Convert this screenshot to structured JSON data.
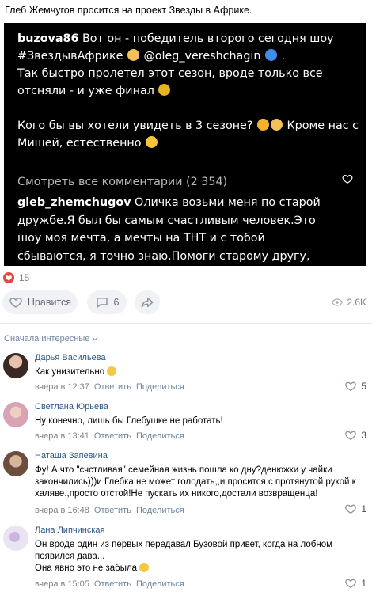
{
  "post": {
    "text": "Глеб Жемчугов просится на проект Звезды в Африке."
  },
  "screenshot": {
    "author1": "buzova86",
    "caption_part1": " Вот он - победитель второго сегодня шоу",
    "hashtag": "#ЗвездывАфрике",
    "mention": "@oleg_vereshchagin",
    "caption_part2": "Так быстро пролетел этот сезон, вроде только все отсняли - и уже финал",
    "caption_part3": "Кого бы вы хотели увидеть в 3 сезоне?",
    "caption_part4": "Кроме нас с Мишей, естественно",
    "view_all": "Смотреть все комментарии (2 354)",
    "author2": "gleb_zhemchugov",
    "reply_text": " Оличка возьми меня по старой дружбе.Я был бы самым счастливым человек.Это шоу моя мечта, а мечты на ТНТ и с тобой сбываются, я точно знаю.Помоги старому другу, пожалуйста"
  },
  "stats": {
    "reactions": "15",
    "like_label": "Нравится",
    "comments": "6",
    "views": "2.6K"
  },
  "sort_label": "Сначала интересные",
  "comments": [
    {
      "author": "Дарья Васильева",
      "text": "Как унизительно",
      "time": "вчера в 12:37",
      "reply": "Ответить",
      "share": "Поделиться",
      "likes": "5"
    },
    {
      "author": "Светлана Юрьева",
      "text": "Ну конечно, лишь бы Глебушке не работать!",
      "time": "вчера в 13:41",
      "reply": "Ответить",
      "share": "Поделиться",
      "likes": "3"
    },
    {
      "author": "Наташа Запевина",
      "text": "Фу! А что \"счстливая\" семейная жизнь пошла ко дну?денюжки у чайки закончились)))и Глебка не может голодать,,и просится с протянутой рукой к халяве.,просто отстой!Не пускать их никого,достали возвращенца!",
      "time": "вчера в 16:48",
      "reply": "Ответить",
      "share": "Поделиться",
      "likes": "1"
    },
    {
      "author": "Лана Липчинская",
      "text": "Он вроде один из первых передавал Бузовой привет, когда на лобном появился дава...",
      "text2": "Она явно это не забыла",
      "time": "вчера в 15:05",
      "reply": "Ответить",
      "share": "Поделиться",
      "likes": "1"
    }
  ],
  "colors": {
    "accent": "#2a5885",
    "meta": "#828282",
    "heart": "#e64646",
    "pill": "#f0f2f5"
  }
}
